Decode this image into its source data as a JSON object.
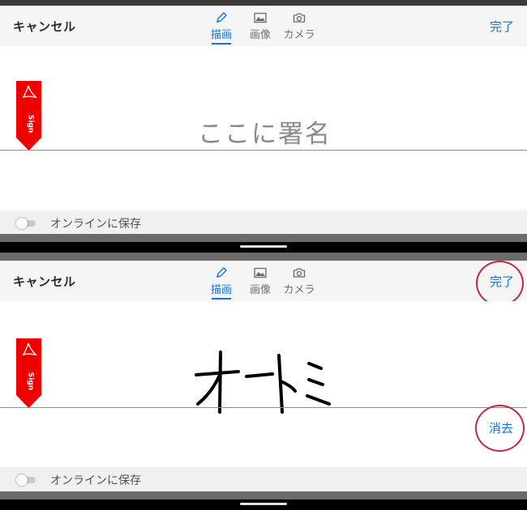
{
  "panels": [
    {
      "header": {
        "cancel_label": "キャンセル",
        "tabs": [
          {
            "label": "描画",
            "icon": "pen-icon",
            "active": true
          },
          {
            "label": "画像",
            "icon": "image-icon",
            "active": false
          },
          {
            "label": "カメラ",
            "icon": "camera-icon",
            "active": false
          }
        ],
        "done_label": "完了"
      },
      "canvas": {
        "placeholder": "ここに署名",
        "badge_text": "Sign"
      },
      "footer": {
        "save_online_label": "オンラインに保存",
        "save_online_on": false
      }
    },
    {
      "header": {
        "cancel_label": "キャンセル",
        "tabs": [
          {
            "label": "描画",
            "icon": "pen-icon",
            "active": true
          },
          {
            "label": "画像",
            "icon": "image-icon",
            "active": false
          },
          {
            "label": "カメラ",
            "icon": "camera-icon",
            "active": false
          }
        ],
        "done_label": "完了"
      },
      "canvas": {
        "badge_text": "Sign",
        "clear_label": "消去"
      },
      "footer": {
        "save_online_label": "オンラインに保存",
        "save_online_on": false
      }
    }
  ],
  "colors": {
    "accent": "#1473e6",
    "highlight_circle": "#c8273f",
    "badge_red": "#ee0000"
  }
}
